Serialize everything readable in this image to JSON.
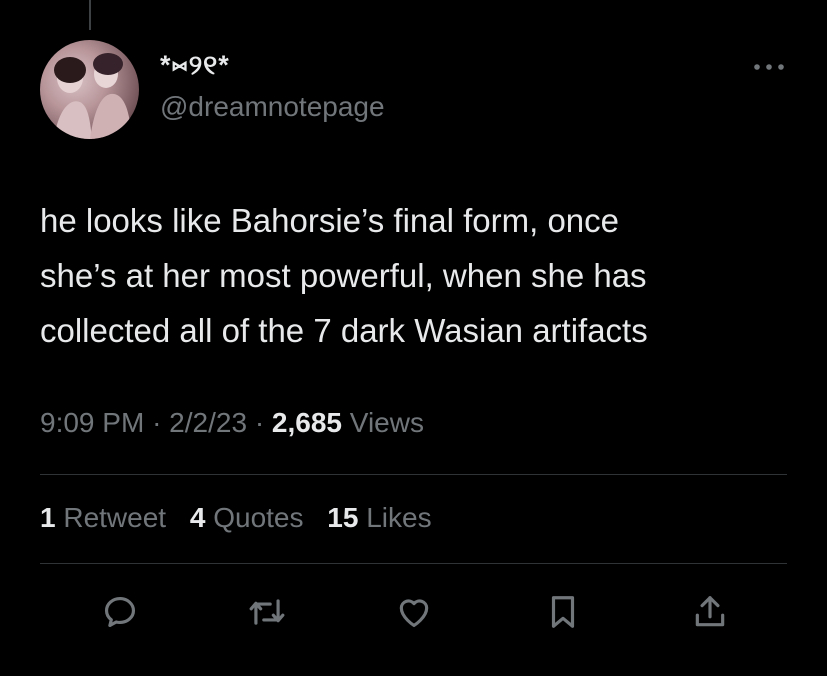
{
  "tweet": {
    "display_name": "*⑅୨୧*",
    "handle": "@dreamnotepage",
    "text_lines": [
      "he looks like Bahorsie’s final form, once",
      "she’s at her most powerful, when she has",
      "collected all of the 7 dark Wasian artifacts"
    ],
    "time": "9:09 PM",
    "date": "2/2/23",
    "separator": "·",
    "views_count": "2,685",
    "views_label": "Views"
  },
  "stats": {
    "retweets_count": "1",
    "retweets_label": "Retweet",
    "quotes_count": "4",
    "quotes_label": "Quotes",
    "likes_count": "15",
    "likes_label": "Likes"
  },
  "actions": {
    "icons": [
      "reply-icon",
      "retweet-icon",
      "like-icon",
      "bookmark-icon",
      "share-icon"
    ]
  },
  "colors": {
    "background": "#000000",
    "primary_text": "#e7e9ea",
    "secondary_text": "#71767b",
    "divider": "#2f3336"
  }
}
